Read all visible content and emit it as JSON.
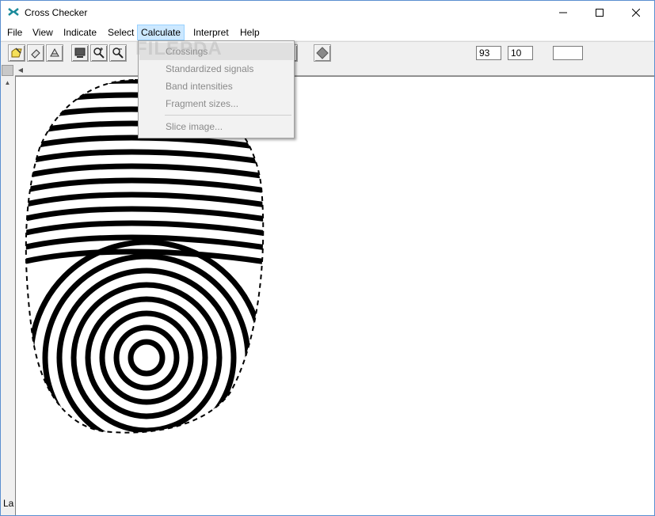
{
  "window": {
    "title": "Cross Checker"
  },
  "menubar": {
    "items": [
      "File",
      "View",
      "Indicate",
      "Select",
      "Calculate",
      "Interpret",
      "Help"
    ],
    "active": "Calculate"
  },
  "calculate_menu": {
    "items": [
      "Crossings",
      "Standardized signals",
      "Band intensities",
      "Fragment sizes...",
      "Slice image..."
    ],
    "highlighted": "Crossings"
  },
  "toolbar": {
    "field1_value": "93",
    "field2_value": "10",
    "field3_value": ""
  },
  "status": {
    "text": "La"
  },
  "watermark": {
    "text": "FILEPDA"
  },
  "icons": {
    "app": "cross-checker-icon",
    "open": "open-folder-icon",
    "erase": "eraser-icon",
    "flip": "flip-icon",
    "display": "monitor-icon",
    "zoom_in": "zoom-in-icon",
    "zoom_out": "zoom-out-icon",
    "marker": "diamond-icon"
  },
  "colors": {
    "accent": "#cce8ff",
    "border": "#99d1ff",
    "frame": "#5a8fd0"
  }
}
